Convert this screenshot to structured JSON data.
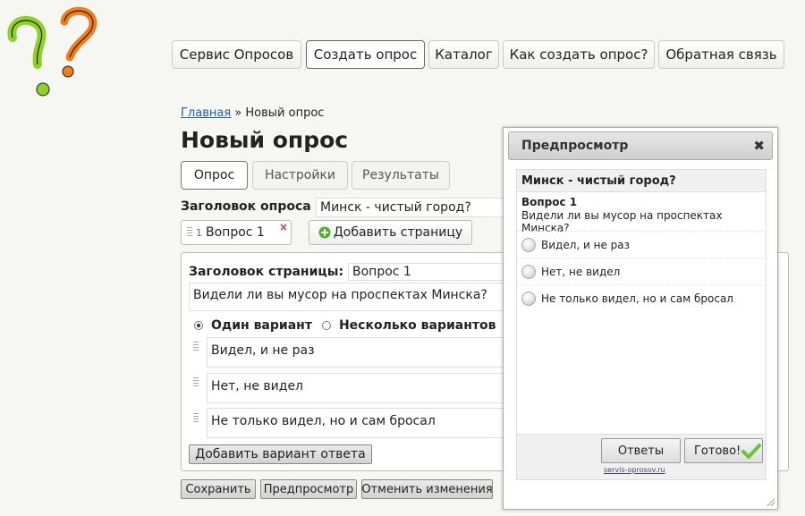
{
  "colors": {
    "logo_green": "#8fd12a",
    "logo_orange": "#f07d1a",
    "link": "#1f5f9f",
    "check_green": "#6cc23a"
  },
  "nav": [
    {
      "label": "Сервис Опросов"
    },
    {
      "label": "Создать опрос"
    },
    {
      "label": "Каталог"
    },
    {
      "label": "Как создать опрос?"
    },
    {
      "label": "Обратная связь"
    }
  ],
  "breadcrumb": {
    "home": "Главная",
    "sep": "»",
    "current": "Новый опрос"
  },
  "page_title": "Новый опрос",
  "tabs": [
    {
      "label": "Опрос"
    },
    {
      "label": "Настройки"
    },
    {
      "label": "Результаты"
    }
  ],
  "survey": {
    "title_label": "Заголовок опроса",
    "title_value": "Минск - чистый город?",
    "page_chip": {
      "number": "1",
      "label": "Вопрос 1",
      "close": "×"
    },
    "add_page_label": "Добавить страницу"
  },
  "page_editor": {
    "page_title_label": "Заголовок страницы:",
    "page_title_value": "Вопрос 1",
    "question_text": "Видели ли вы мусор на проспектах Минска?",
    "mode_single": "Один вариант",
    "mode_multi": "Несколько вариантов",
    "options": [
      "Видел, и не раз",
      "Нет, не видел",
      "Не только видел, но и сам бросал"
    ],
    "add_option_label": "Добавить вариант ответа"
  },
  "actions": {
    "save": "Сохранить",
    "preview": "Предпросмотр",
    "cancel": "Отменить изменения"
  },
  "preview": {
    "header": "Предпросмотр",
    "close": "✖",
    "survey_title": "Минск - чистый город?",
    "question_label": "Вопрос 1",
    "question_text": "Видели ли вы мусор на проспектах Минска?",
    "options": [
      "Видел, и не раз",
      "Нет, не видел",
      "Не только видел, но и сам бросал"
    ],
    "answers_button": "Ответы",
    "done_button": "Готово!",
    "credit": "servis-oprosov.ru"
  }
}
